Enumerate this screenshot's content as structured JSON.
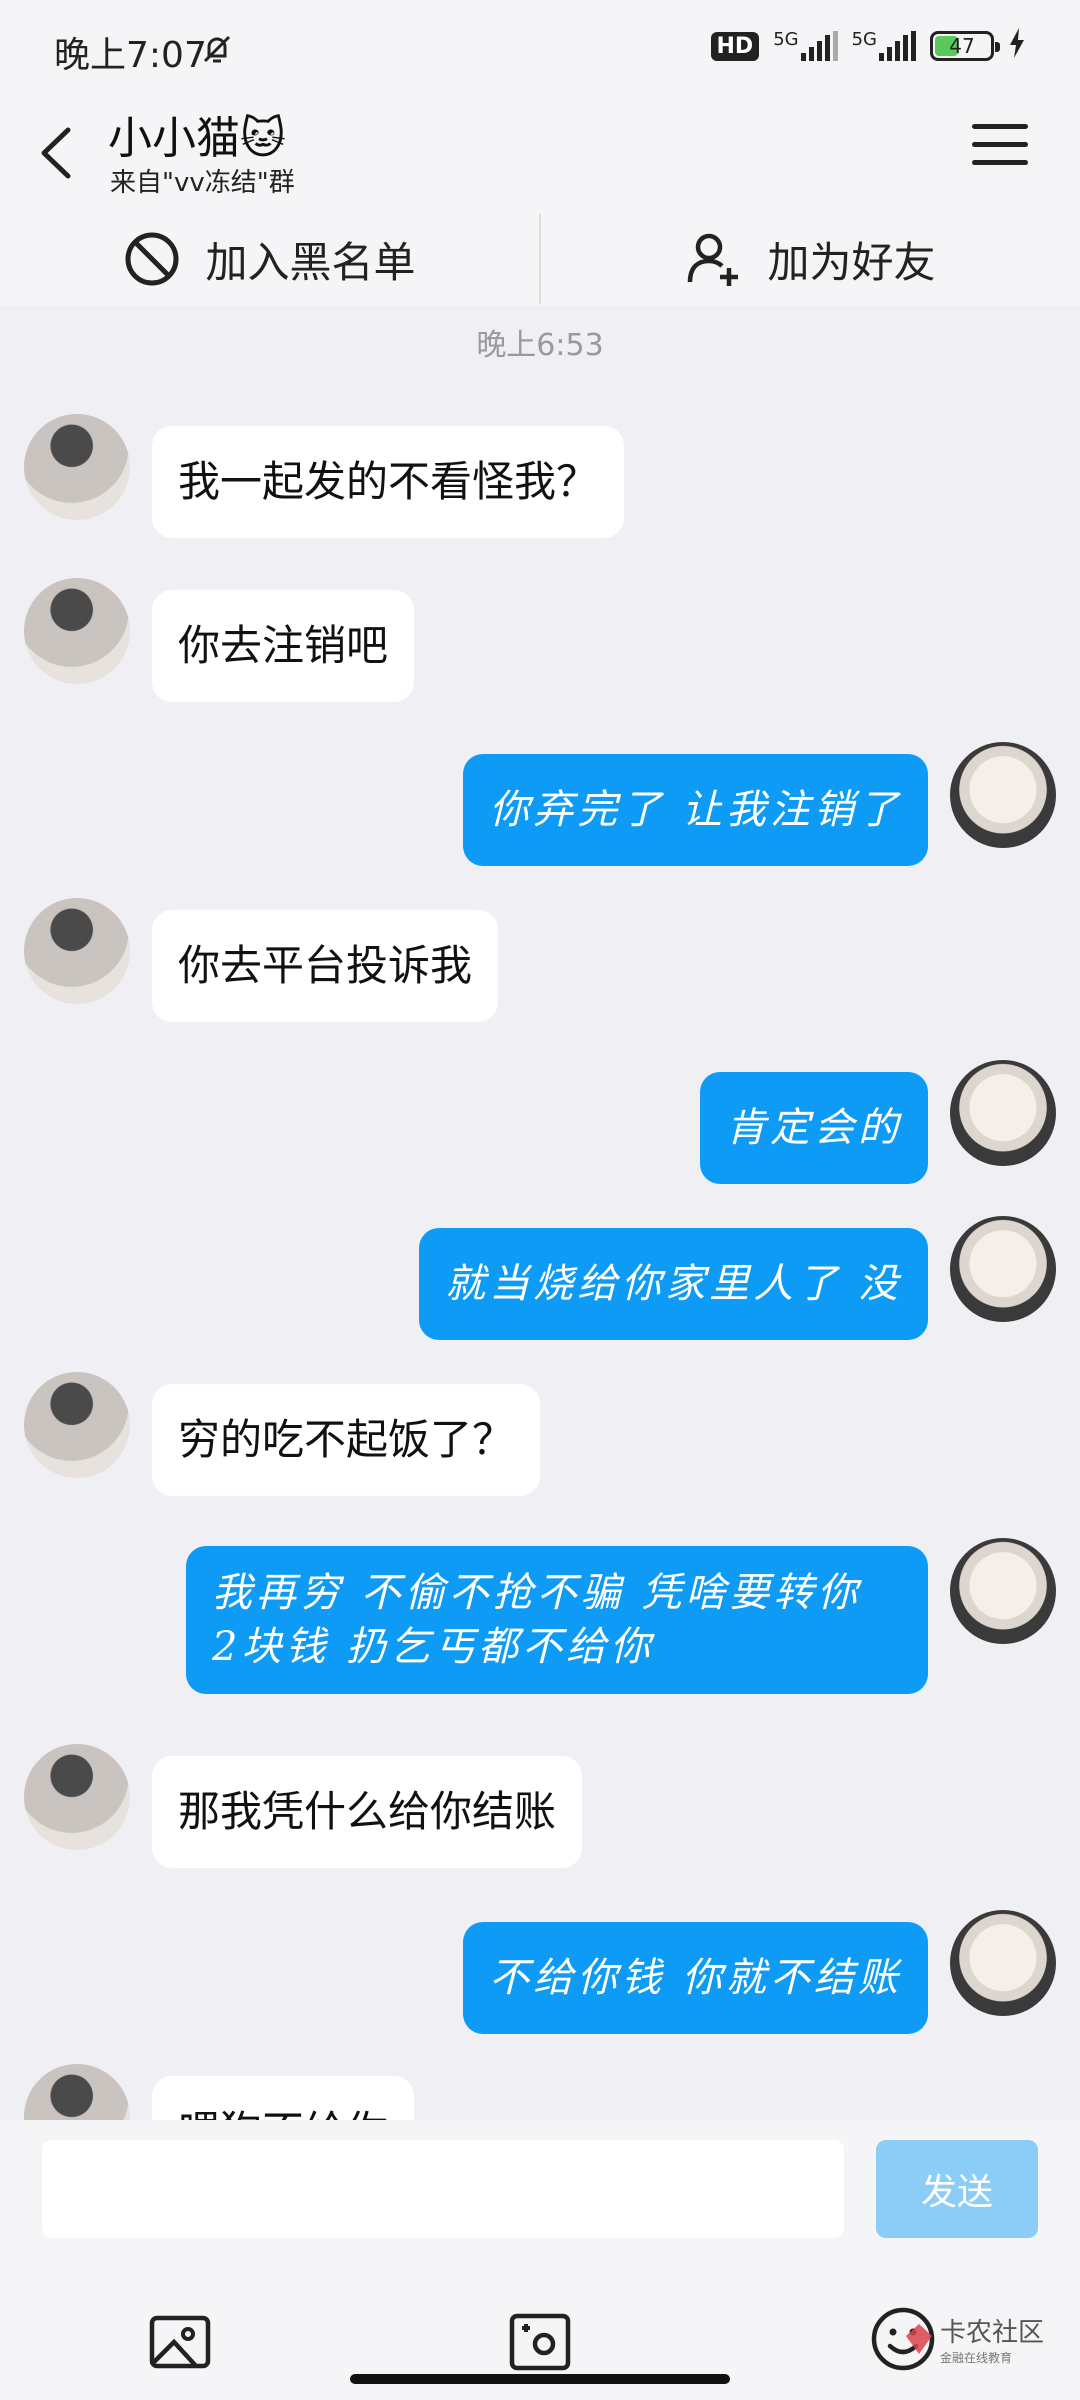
{
  "status_bar": {
    "time": "晚上7:07",
    "hd_label": "HD",
    "network_1": "5G",
    "network_2": "5G",
    "battery_level": 47,
    "battery_label": "47"
  },
  "header": {
    "title": "小小猫🐱",
    "subtitle": "来自\"vv冻结\"群"
  },
  "actions": {
    "block": "加入黑名单",
    "add_friend": "加为好友"
  },
  "chat": {
    "timestamp": "晚上6:53",
    "messages": [
      {
        "side": "in",
        "text": "我一起发的不看怪我？"
      },
      {
        "side": "in",
        "text": "你去注销吧"
      },
      {
        "side": "out",
        "text": "你弃完了 让我注销了"
      },
      {
        "side": "in",
        "text": "你去平台投诉我"
      },
      {
        "side": "out",
        "text": "肯定会的"
      },
      {
        "side": "out",
        "text": "就当烧给你家里人了 没"
      },
      {
        "side": "in",
        "text": "穷的吃不起饭了？"
      },
      {
        "side": "out",
        "text": "我再穷 不偷不抢不骗 凭啥要转你\n2块钱 扔乞丐都不给你"
      },
      {
        "side": "in",
        "text": "那我凭什么给你结账"
      },
      {
        "side": "out",
        "text": "不给你钱 你就不结账"
      },
      {
        "side": "in",
        "text": "喂狗不给你"
      }
    ]
  },
  "input": {
    "value": "",
    "send_label": "发送"
  },
  "watermark": {
    "text": "卡农社区",
    "sub": "金融在线教育"
  },
  "colors": {
    "outgoing_bubble": "#0d9bf5",
    "send_button": "#8ccdf7"
  }
}
